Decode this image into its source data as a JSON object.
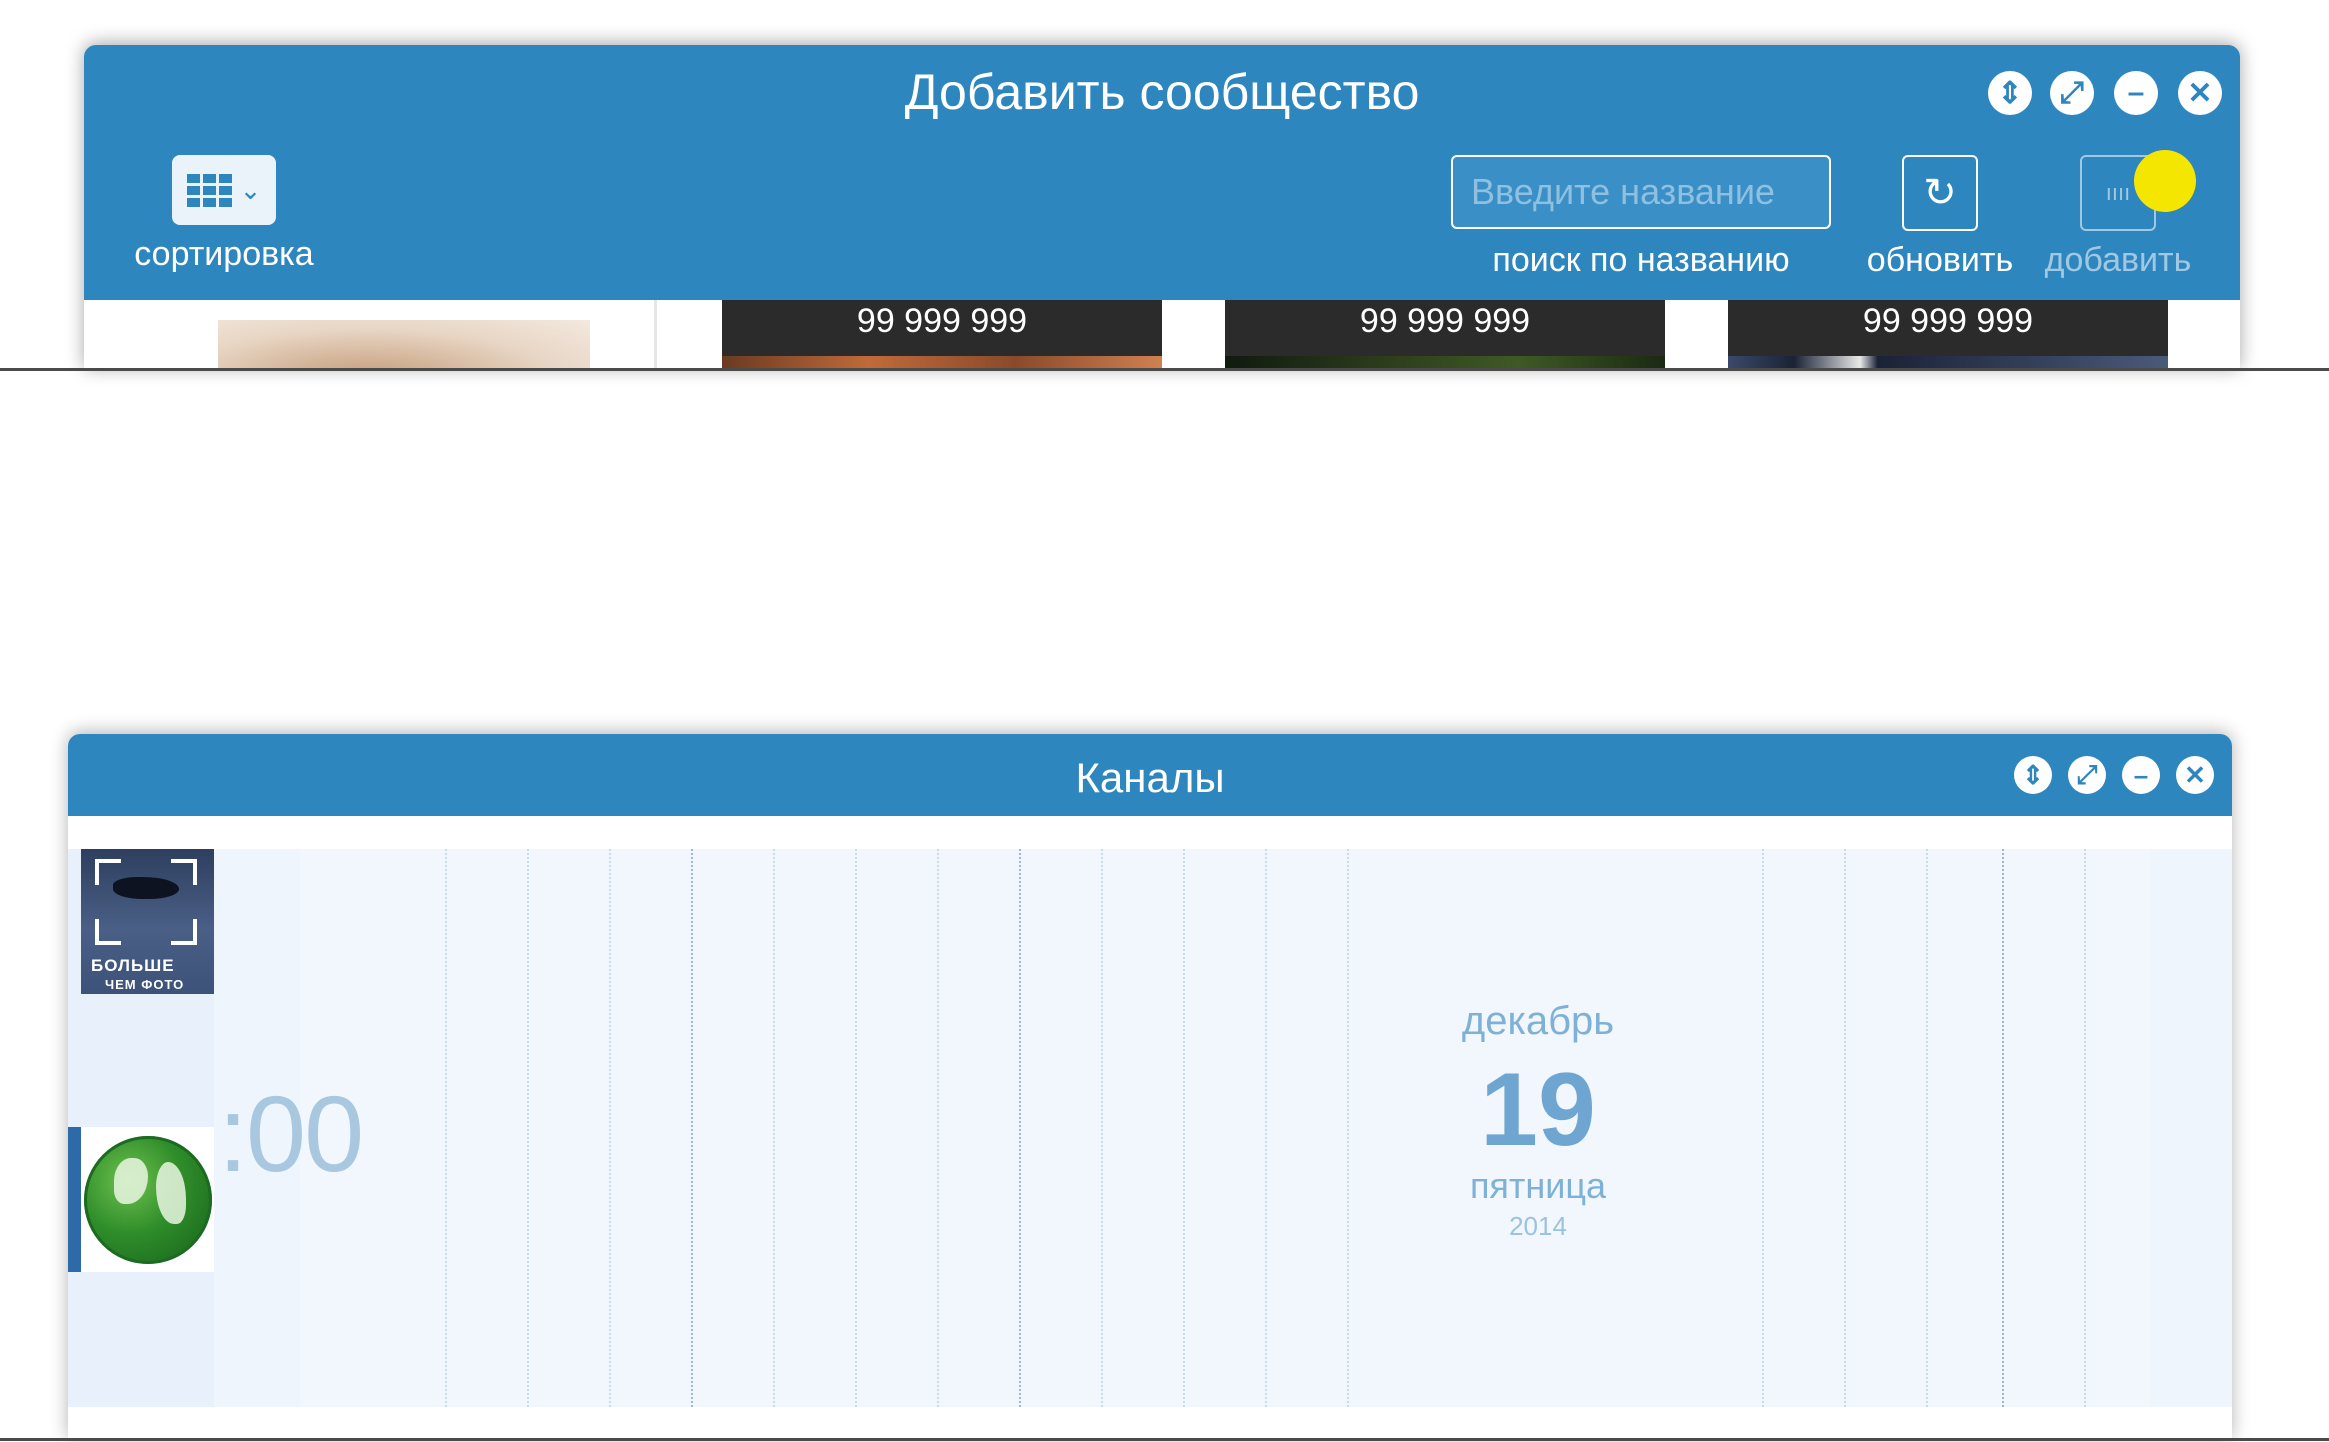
{
  "top_window": {
    "title": "Добавить сообщество",
    "controls": [
      "sort-updown-icon",
      "fullscreen-icon",
      "minimize-icon",
      "close-icon"
    ],
    "toolbar": {
      "sort_label": "сортировка",
      "search_placeholder": "Введите название",
      "search_label": "поиск по названию",
      "refresh_label": "обновить",
      "add_label": "добавить"
    },
    "cards": [
      {
        "count": "99 999 999"
      },
      {
        "count": "99 999 999"
      },
      {
        "count": "99 999 999"
      }
    ]
  },
  "bottom_window": {
    "title": "Каналы",
    "controls": [
      "sort-updown-icon",
      "fullscreen-icon",
      "minimize-icon",
      "close-icon"
    ],
    "channels": [
      {
        "name": "bolshe-chem-foto",
        "line1": "БОЛЬШЕ",
        "line2": "ЧЕМ ФОТО"
      },
      {
        "name": "globe"
      }
    ],
    "timeline": {
      "time": ":00",
      "month": "декабрь",
      "day": "19",
      "weekday": "пятница",
      "year": "2014"
    }
  },
  "colors": {
    "accent": "#2e86bf",
    "cursor": "#f5e600",
    "timeline_bg": "#f1f7fd"
  }
}
